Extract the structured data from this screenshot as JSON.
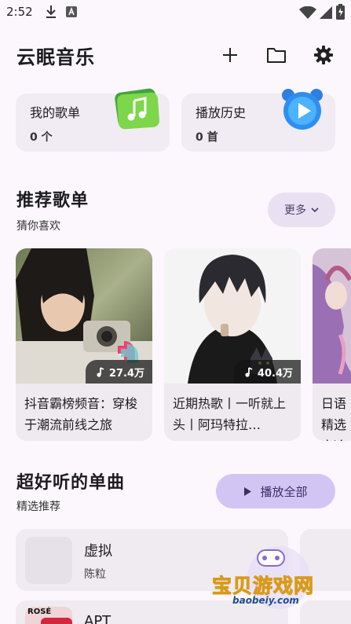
{
  "status_bar": {
    "time": "2:52"
  },
  "app": {
    "title": "云眠音乐"
  },
  "library": [
    {
      "label": "我的歌单",
      "count": "0 个"
    },
    {
      "label": "播放历史",
      "count": "0 首"
    }
  ],
  "recommend": {
    "title": "推荐歌单",
    "subtitle": "猜你喜欢",
    "more_label": "更多",
    "playlists": [
      {
        "name": "抖音霸榜频音：穿梭于潮流前线之旅",
        "count": "27.4万"
      },
      {
        "name": "近期热歌丨一听就上头丨阿玛特拉…",
        "count": "40.4万"
      },
      {
        "name": "日语精选 亦冷亦暖",
        "count": ""
      }
    ]
  },
  "singles": {
    "title": "超好听的单曲",
    "subtitle": "精选推荐",
    "play_all_label": "播放全部",
    "songs": [
      {
        "title": "虚拟",
        "artist": "陈粒"
      },
      {
        "title": "APT",
        "artist": "",
        "cover_text": "ROSÉ"
      }
    ]
  },
  "watermark": {
    "text": "宝贝游戏网",
    "url": "baobeiy.com"
  },
  "colors": {
    "background": "#fbf7fc",
    "card": "#f1ebf4",
    "accent": "#d3c5f3"
  }
}
